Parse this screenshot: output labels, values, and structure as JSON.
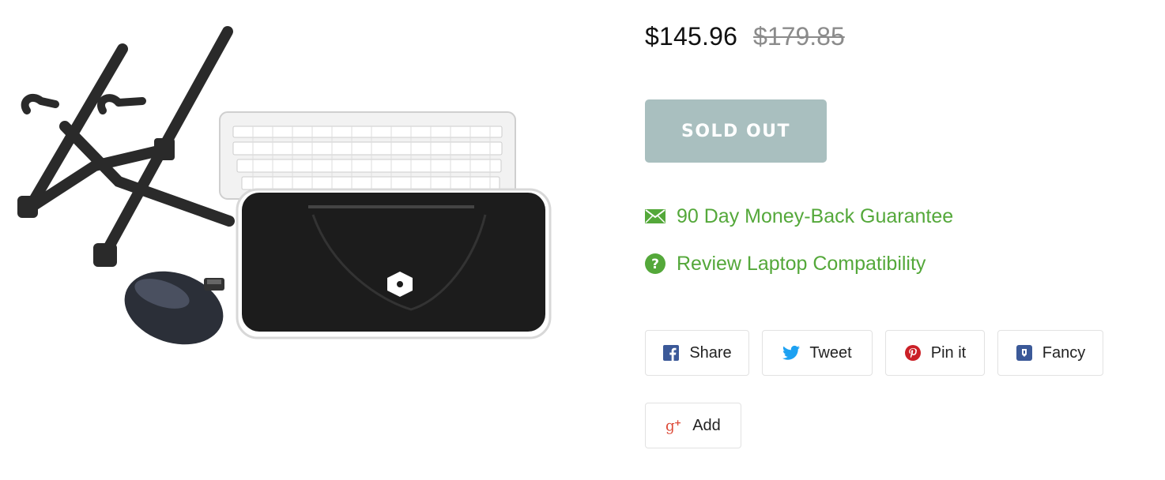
{
  "price": {
    "current": "$145.96",
    "original": "$179.85"
  },
  "sold_out_label": "SOLD OUT",
  "info_links": {
    "guarantee": "90 Day Money-Back Guarantee",
    "compatibility": "Review Laptop Compatibility"
  },
  "social": {
    "share": "Share",
    "tweet": "Tweet",
    "pin": "Pin it",
    "fancy": "Fancy",
    "gplus": "Add"
  },
  "colors": {
    "accent_green": "#54a83a",
    "sold_out_bg": "#a9bfbf",
    "facebook": "#3b5998",
    "twitter": "#1da1f2",
    "pinterest": "#cb2027",
    "fancy": "#3b5998",
    "gplus": "#dd4b39"
  },
  "icons": {
    "guarantee": "envelope-icon",
    "compatibility": "question-circle-icon",
    "share": "facebook-icon",
    "tweet": "twitter-icon",
    "pin": "pinterest-icon",
    "fancy": "fancy-icon",
    "gplus": "google-plus-icon"
  }
}
